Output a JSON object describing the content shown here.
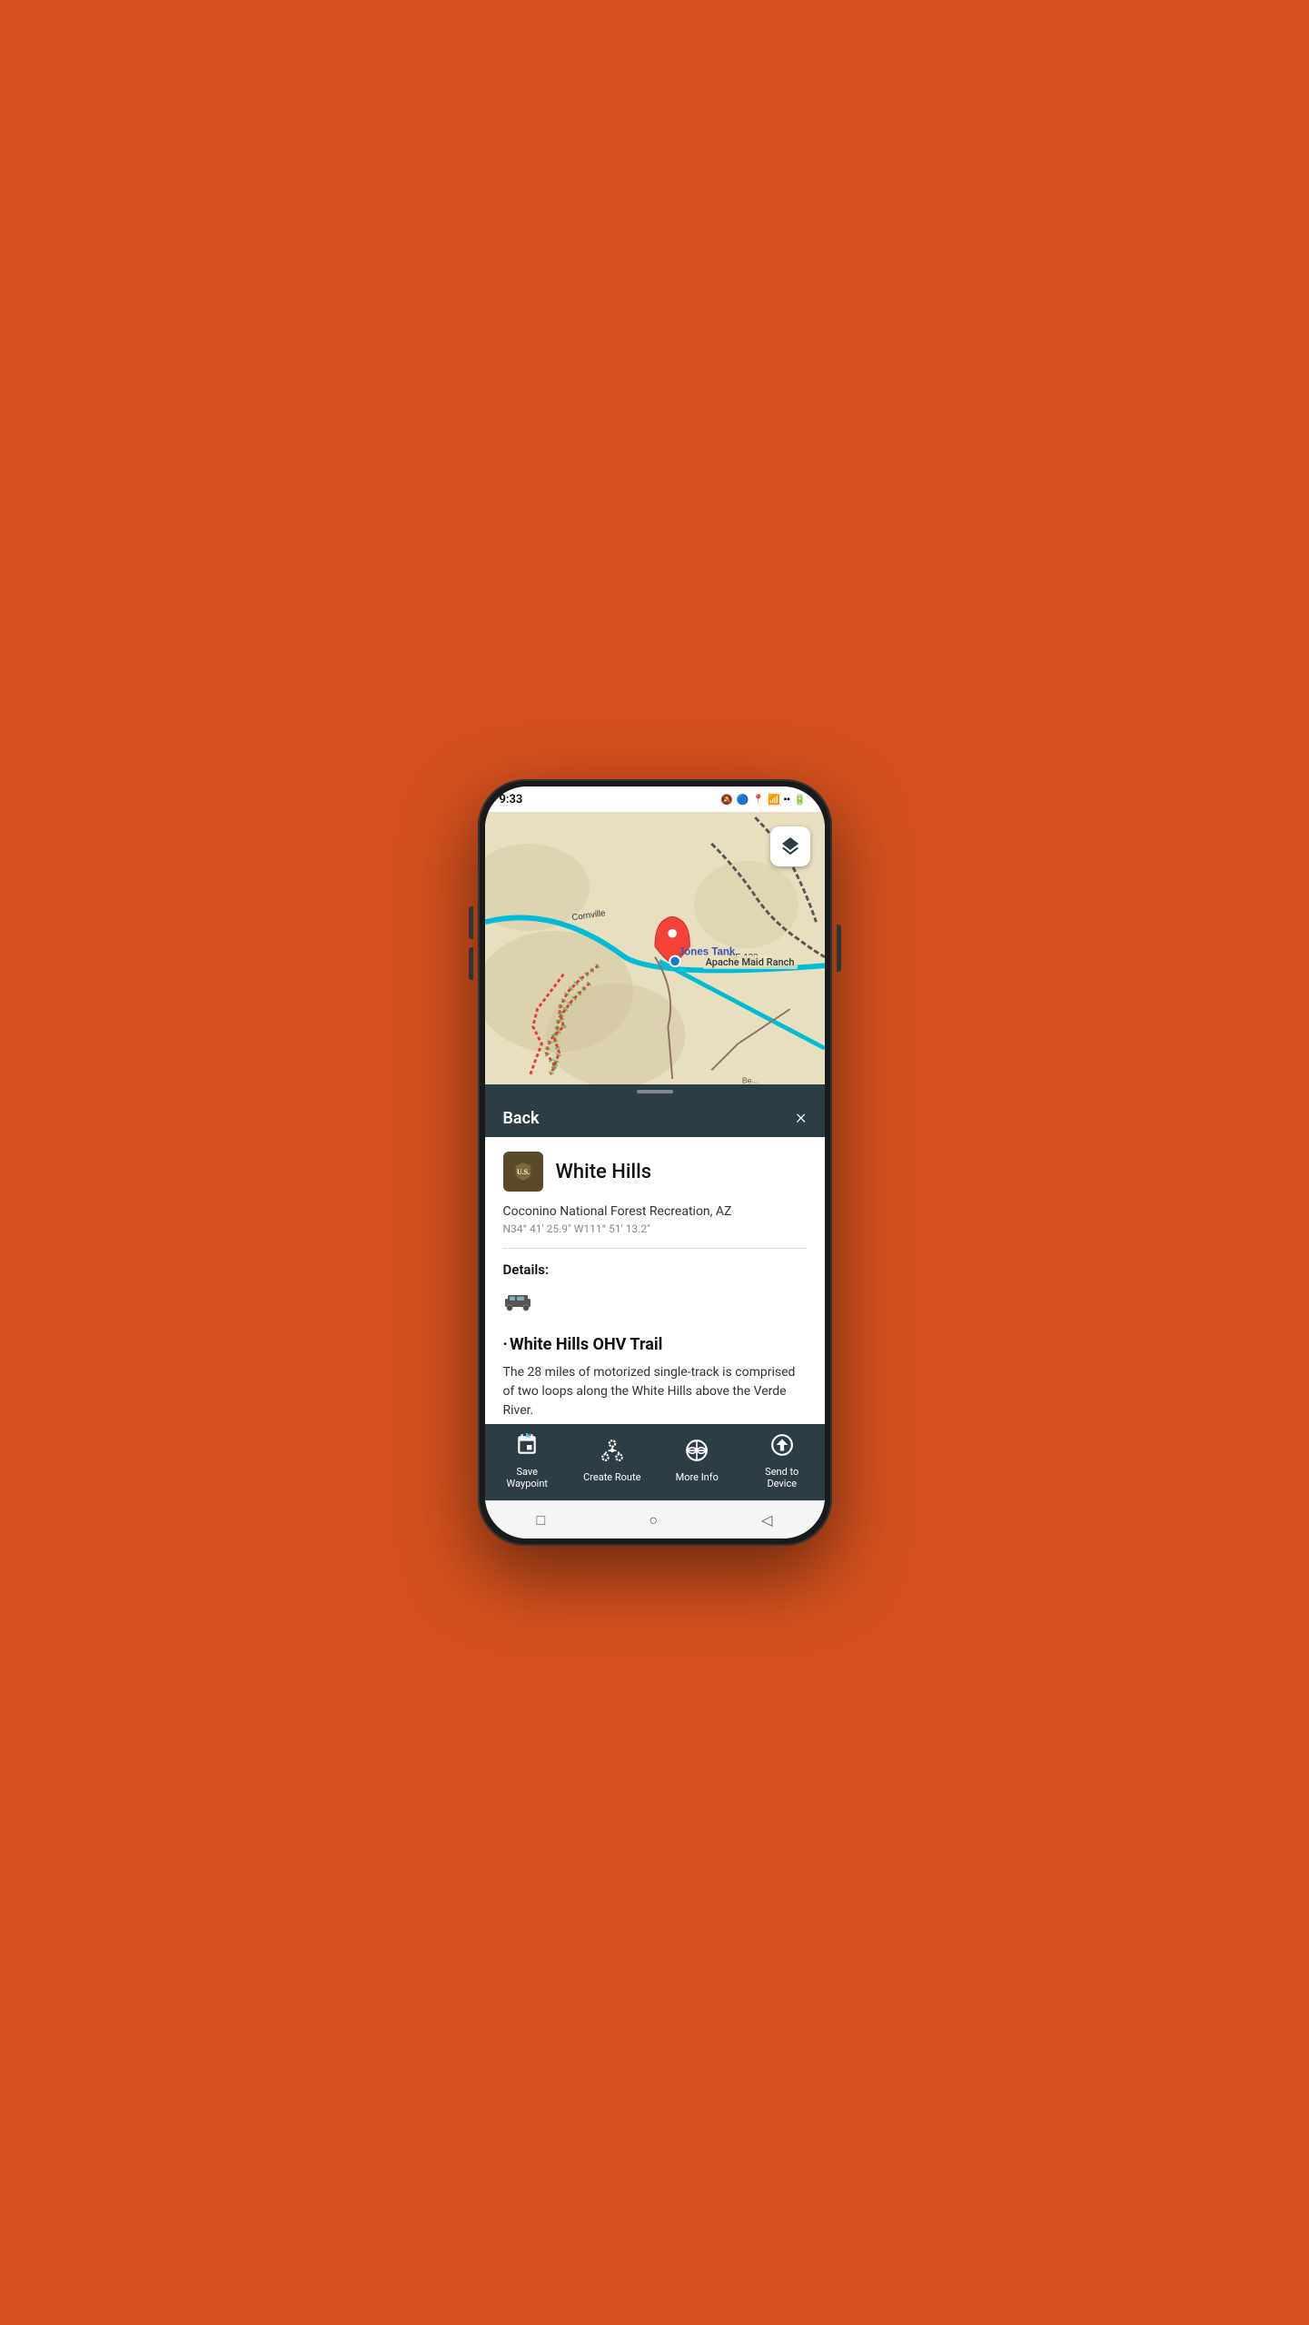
{
  "phone": {
    "status_bar": {
      "time": "9:33",
      "icons": [
        "📶",
        "🔵",
        "📍",
        "📶",
        "🔋"
      ]
    },
    "map": {
      "layer_btn_label": "layers"
    },
    "sheet_header": {
      "back_label": "Back",
      "close_label": "×"
    },
    "poi": {
      "title": "White Hills",
      "icon": "🛡",
      "subtitle": "Coconino National Forest Recreation, AZ",
      "coords": "N34° 41' 25.9\" W111° 51' 13.2\"",
      "details_label": "Details:",
      "details_icon": "🚙",
      "trail_title": "White Hills OHV Trail",
      "trail_desc": "The 28 miles of motorized single-track is comprised of two loops along the White Hills above the Verde River."
    },
    "toolbar": {
      "buttons": [
        {
          "id": "save-waypoint",
          "icon": "🚩",
          "label": "Save\nWaypoint"
        },
        {
          "id": "create-route",
          "icon": "✦",
          "label": "Create Route"
        },
        {
          "id": "more-info",
          "icon": "🌐",
          "label": "More Info"
        },
        {
          "id": "send-to-device",
          "icon": "➤",
          "label": "Send to\nDevice"
        }
      ]
    },
    "nav_bar": {
      "buttons": [
        "□",
        "○",
        "◁"
      ]
    }
  }
}
